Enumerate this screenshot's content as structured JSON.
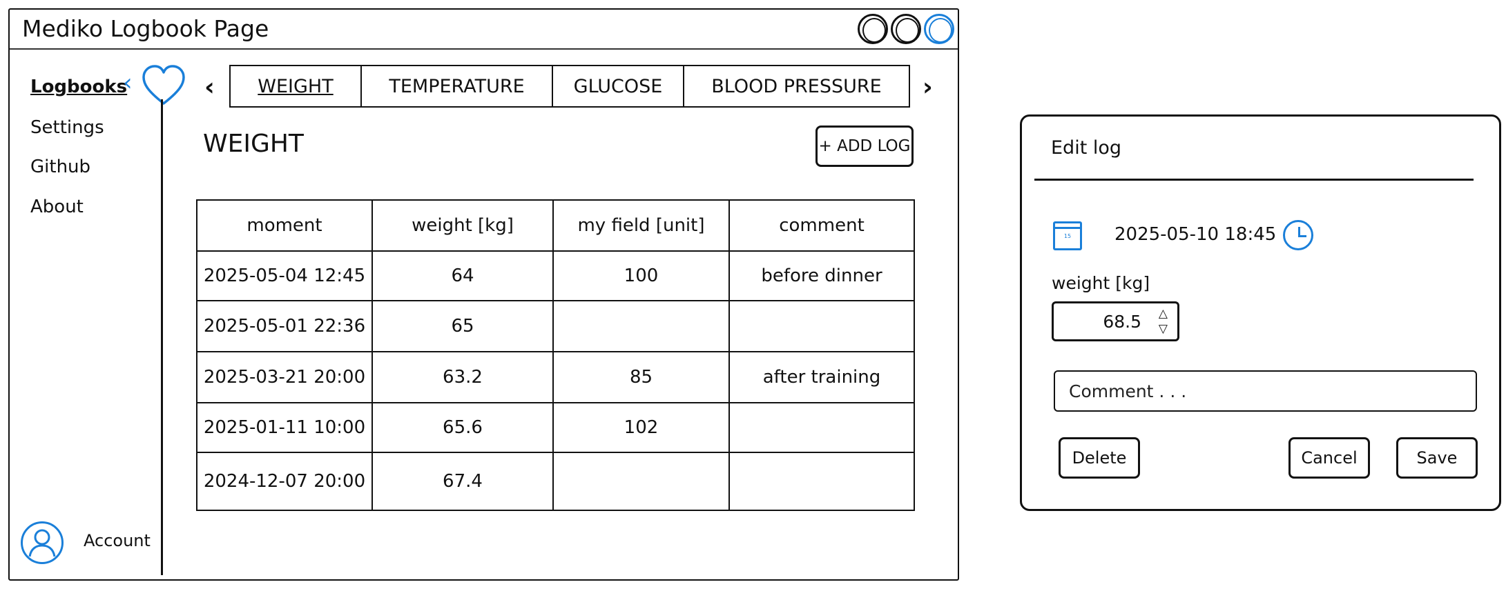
{
  "window": {
    "title": "Mediko Logbook Page"
  },
  "sidebar": {
    "items": [
      {
        "label": "Logbooks",
        "active": true
      },
      {
        "label": "Settings"
      },
      {
        "label": "Github"
      },
      {
        "label": "About"
      }
    ],
    "account_label": "Account"
  },
  "tabs": [
    {
      "label": "WEIGHT",
      "active": true
    },
    {
      "label": "TEMPERATURE"
    },
    {
      "label": "GLUCOSE"
    },
    {
      "label": "BLOOD PRESSURE"
    }
  ],
  "section": {
    "title": "WEIGHT",
    "add_button_label": "+ ADD LOG"
  },
  "table": {
    "columns": [
      "moment",
      "weight [kg]",
      "my field [unit]",
      "comment"
    ],
    "rows": [
      [
        "2025-05-04 12:45",
        "64",
        "100",
        "before dinner"
      ],
      [
        "2025-05-01 22:36",
        "65",
        "",
        ""
      ],
      [
        "2025-03-21 20:00",
        "63.2",
        "85",
        "after training"
      ],
      [
        "2025-01-11 10:00",
        "65.6",
        "102",
        ""
      ],
      [
        "2024-12-07 20:00",
        "67.4",
        "",
        ""
      ]
    ]
  },
  "dialog": {
    "title": "Edit log",
    "calendar_day": "15",
    "datetime": "2025-05-10  18:45",
    "weight_label": "weight [kg]",
    "weight_value": "68.5",
    "comment_placeholder": "Comment . . .",
    "delete_label": "Delete",
    "cancel_label": "Cancel",
    "save_label": "Save"
  },
  "colors": {
    "accent": "#1a7fd9",
    "ink": "#111111"
  }
}
